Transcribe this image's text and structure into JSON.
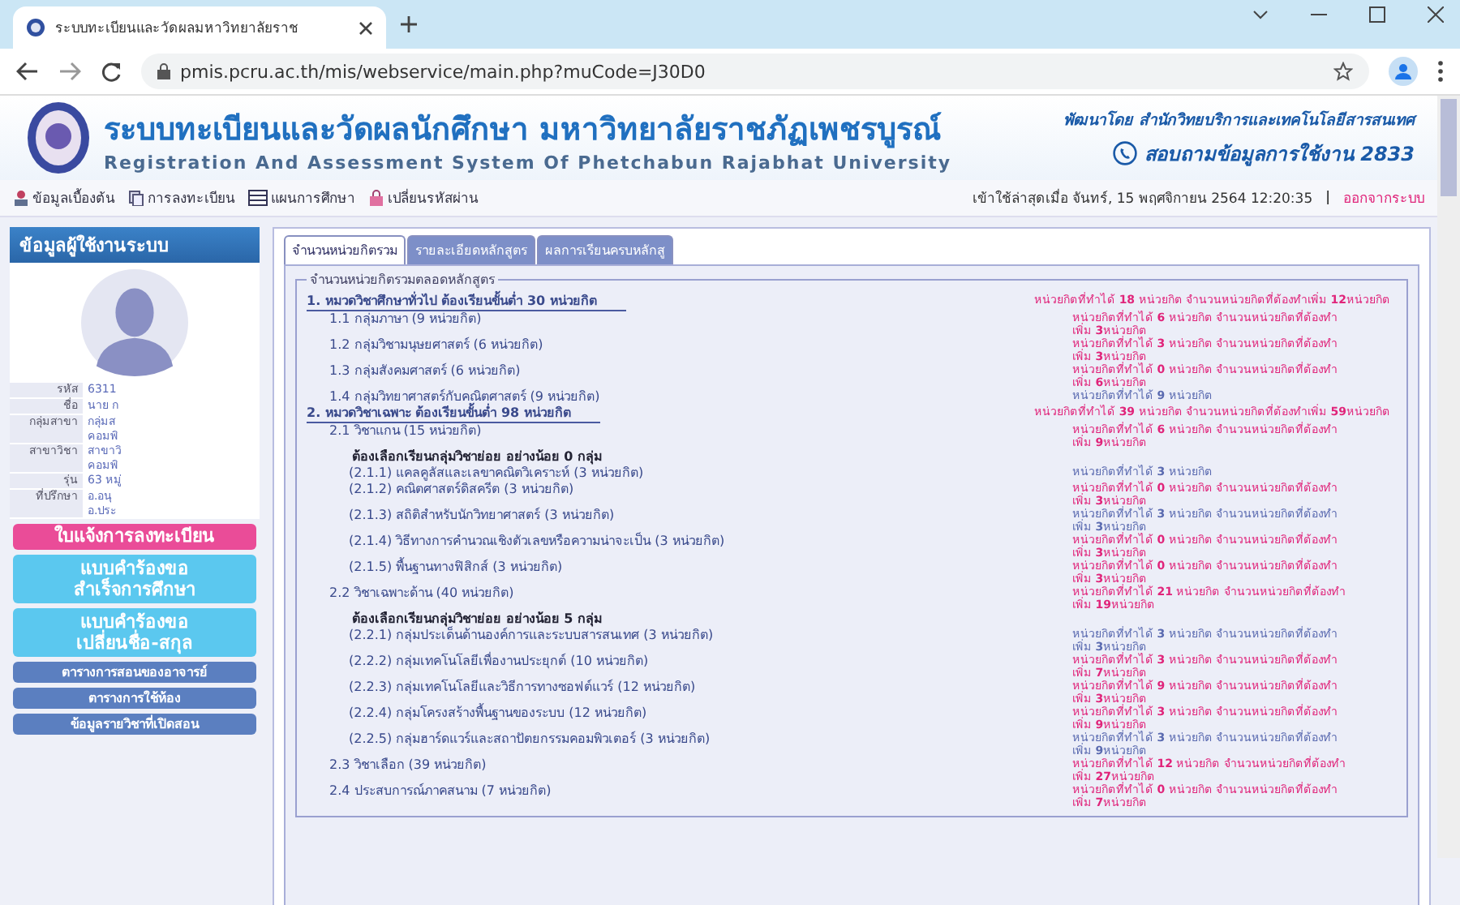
{
  "browser": {
    "tab_title": "ระบบทะเบียนและวัดผลมหาวิทยาลัยราช",
    "url": "pmis.pcru.ac.th/mis/webservice/main.php?muCode=J30D0"
  },
  "header": {
    "title": "ระบบทะเบียนและวัดผลนักศึกษา มหาวิทยาลัยราชภัฏเพชรบูรณ์",
    "subtitle": "Registration And Assessment System Of Phetchabun Rajabhat University",
    "developer": "พัฒนาโดย สำนักวิทยบริการและเทคโนโลยีสารสนเทศ",
    "contact": "สอบถามข้อมูลการใช้งาน 2833"
  },
  "nav": {
    "items": [
      "ข้อมูลเบื้องต้น",
      "การลงทะเบียน",
      "แผนการศึกษา",
      "เปลี่ยนรหัสผ่าน"
    ],
    "last_login": "เข้าใช้ล่าสุดเมื่อ จันทร์, 15 พฤศจิกายน 2564 12:20:35",
    "separator": "|",
    "logout": "ออกจากระบบ"
  },
  "sidebar": {
    "title": "ข้อมูลผู้ใช้งานระบบ",
    "profile": [
      {
        "label": "รหัส",
        "value": [
          "6311"
        ]
      },
      {
        "label": "ชื่อ",
        "value": [
          "นาย ก"
        ]
      },
      {
        "label": "กลุ่มสาขา",
        "value": [
          "กลุ่มส",
          "คอมพิ"
        ]
      },
      {
        "label": "สาขาวิชา",
        "value": [
          "สาขาวิ",
          "คอมพิ"
        ]
      },
      {
        "label": "รุ่น",
        "value": [
          "63 หมู่"
        ]
      },
      {
        "label": "ที่ปรึกษา",
        "value": [
          "อ.อนุ",
          "อ.ประ"
        ]
      }
    ],
    "buttons": [
      {
        "kind": "pink",
        "lines": [
          "ใบแจ้งการลงทะเบียน"
        ]
      },
      {
        "kind": "cyan",
        "lines": [
          "แบบคำร้องขอ",
          "สำเร็จการศึกษา"
        ]
      },
      {
        "kind": "cyan",
        "lines": [
          "แบบคำร้องขอ",
          "เปลี่ยนชื่อ-สกุล"
        ]
      },
      {
        "kind": "blue",
        "lines": [
          "ตารางการสอนของอาจารย์"
        ]
      },
      {
        "kind": "blue",
        "lines": [
          "ตารางการใช้ห้อง"
        ]
      },
      {
        "kind": "blue",
        "lines": [
          "ข้อมูลรายวิชาที่เปิดสอน"
        ]
      }
    ]
  },
  "tabs": [
    {
      "label": "จำนวนหน่วยกิตรวม",
      "selected": true
    },
    {
      "label": "รายละเอียดหลักสูตร",
      "selected": false
    },
    {
      "label": "ผลการเรียนครบหลักสู",
      "selected": false
    }
  ],
  "panel": {
    "legend": "จำนวนหน่วยกิตรวมตลอดหลักสูตร",
    "categories": [
      {
        "title": "1. หมวดวิชาศึกษาทั่วไป  ต้องเรียนขั้นต่ำ  30 หน่วยกิต",
        "complete": false,
        "status": [
          "หน่วยกิตที่ทำได้ **18** หน่วยกิต   จำนวนหน่วยกิตที่ต้องทำเพิ่ม  **12**หน่วยกิต"
        ],
        "children": [
          {
            "title": "1.1 กลุ่มภาษา (9 หน่วยกิต)",
            "complete": false,
            "status": [
              "หน่วยกิตที่ทำได้ **6** หน่วยกิต  จำนวนหน่วยกิตที่ต้องทำ",
              "เพิ่ม **3**หน่วยกิต"
            ]
          },
          {
            "title": "1.2 กลุ่มวิชามนุษยศาสตร์ (6 หน่วยกิต)",
            "complete": false,
            "status": [
              "หน่วยกิตที่ทำได้ **3** หน่วยกิต  จำนวนหน่วยกิตที่ต้องทำ",
              "เพิ่ม **3**หน่วยกิต"
            ]
          },
          {
            "title": "1.3 กลุ่มสังคมศาสตร์ (6 หน่วยกิต)",
            "complete": false,
            "status": [
              "หน่วยกิตที่ทำได้ **0** หน่วยกิต  จำนวนหน่วยกิตที่ต้องทำ",
              "เพิ่ม **6**หน่วยกิต"
            ]
          },
          {
            "title": "1.4 กลุ่มวิทยาศาสตร์กับคณิตศาสตร์ (9 หน่วยกิต)",
            "complete": true,
            "status": [
              "หน่วยกิตที่ทำได้ **9** หน่วยกิต"
            ]
          }
        ]
      },
      {
        "title": "2. หมวดวิชาเฉพาะ  ต้องเรียนขั้นต่ำ  98 หน่วยกิต",
        "complete": false,
        "status": [
          "หน่วยกิตที่ทำได้ **39** หน่วยกิต   จำนวนหน่วยกิตที่ต้องทำเพิ่ม  **59**หน่วยกิต"
        ],
        "children": [
          {
            "title": "2.1 วิชาแกน (15 หน่วยกิต)",
            "complete": false,
            "status": [
              "หน่วยกิตที่ทำได้ **6** หน่วยกิต  จำนวนหน่วยกิตที่ต้องทำ",
              "เพิ่ม **9**หน่วยกิต"
            ],
            "note": "ต้องเลือกเรียนกลุ่มวิชาย่อย อย่างน้อย 0 กลุ่ม",
            "children": [
              {
                "title": "(2.1.1) แคลคูลัสและเลขาคณิตวิเคราะห์ (3 หน่วยกิต)",
                "complete": true,
                "status": [
                  "หน่วยกิตที่ทำได้ **3** หน่วยกิต"
                ]
              },
              {
                "title": "(2.1.2) คณิตศาสตร์ดิสครีต (3 หน่วยกิต)",
                "complete": false,
                "status": [
                  "หน่วยกิตที่ทำได้ **0** หน่วยกิต  จำนวนหน่วยกิตที่ต้องทำ",
                  "เพิ่ม **3**หน่วยกิต"
                ]
              },
              {
                "title": "(2.1.3) สถิติสำหรับนักวิทยาศาสตร์ (3 หน่วยกิต)",
                "complete": true,
                "status": [
                  "หน่วยกิตที่ทำได้ **3** หน่วยกิต  จำนวนหน่วยกิตที่ต้องทำ",
                  "เพิ่ม **3**หน่วยกิต"
                ]
              },
              {
                "title": "(2.1.4) วิธีทางการคำนวณเชิงตัวเลขหรือความน่าจะเป็น (3 หน่วยกิต)",
                "complete": false,
                "status": [
                  "หน่วยกิตที่ทำได้ **0** หน่วยกิต  จำนวนหน่วยกิตที่ต้องทำ",
                  "เพิ่ม **3**หน่วยกิต"
                ]
              },
              {
                "title": "(2.1.5) พื้นฐานทางฟิสิกส์ (3 หน่วยกิต)",
                "complete": false,
                "status": [
                  "หน่วยกิตที่ทำได้ **0** หน่วยกิต  จำนวนหน่วยกิตที่ต้องทำ",
                  "เพิ่ม **3**หน่วยกิต"
                ]
              }
            ]
          },
          {
            "title": "2.2 วิชาเฉพาะด้าน (40 หน่วยกิต)",
            "complete": false,
            "status": [
              "หน่วยกิตที่ทำได้ **21** หน่วยกิต  จำนวนหน่วยกิตที่ต้องทำ",
              "เพิ่ม **19**หน่วยกิต"
            ],
            "note": "ต้องเลือกเรียนกลุ่มวิชาย่อย อย่างน้อย 5 กลุ่ม",
            "children": [
              {
                "title": "(2.2.1) กลุ่มประเด็นด้านองค์การและระบบสารสนเทศ (3 หน่วยกิต)",
                "complete": true,
                "status": [
                  "หน่วยกิตที่ทำได้ **3** หน่วยกิต  จำนวนหน่วยกิตที่ต้องทำ",
                  "เพิ่ม **3**หน่วยกิต"
                ]
              },
              {
                "title": "(2.2.2) กลุ่มเทคโนโลยีเพื่องานประยุกต์ (10 หน่วยกิต)",
                "complete": false,
                "status": [
                  "หน่วยกิตที่ทำได้ **3** หน่วยกิต  จำนวนหน่วยกิตที่ต้องทำ",
                  "เพิ่ม **7**หน่วยกิต"
                ]
              },
              {
                "title": "(2.2.3) กลุ่มเทคโนโลยีและวิธีการทางซอฟต์แวร์ (12 หน่วยกิต)",
                "complete": false,
                "status": [
                  "หน่วยกิตที่ทำได้ **9** หน่วยกิต  จำนวนหน่วยกิตที่ต้องทำ",
                  "เพิ่ม **3**หน่วยกิต"
                ]
              },
              {
                "title": "(2.2.4) กลุ่มโครงสร้างพื้นฐานของระบบ (12 หน่วยกิต)",
                "complete": false,
                "status": [
                  "หน่วยกิตที่ทำได้ **3** หน่วยกิต  จำนวนหน่วยกิตที่ต้องทำ",
                  "เพิ่ม **9**หน่วยกิต"
                ]
              },
              {
                "title": "(2.2.5) กลุ่มฮาร์ดแวร์และสถาปัตยกรรมคอมพิวเตอร์ (3 หน่วยกิต)",
                "complete": true,
                "status": [
                  "หน่วยกิตที่ทำได้ **3** หน่วยกิต  จำนวนหน่วยกิตที่ต้องทำ",
                  "เพิ่ม **9**หน่วยกิต"
                ]
              }
            ]
          },
          {
            "title": "2.3 วิชาเลือก (39 หน่วยกิต)",
            "complete": false,
            "status": [
              "หน่วยกิตที่ทำได้ **12** หน่วยกิต  จำนวนหน่วยกิตที่ต้องทำ",
              "เพิ่ม **27**หน่วยกิต"
            ]
          },
          {
            "title": "2.4 ประสบการณ์ภาคสนาม (7 หน่วยกิต)",
            "complete": false,
            "status": [
              "หน่วยกิตที่ทำได้ **0** หน่วยกิต  จำนวนหน่วยกิตที่ต้องทำ",
              "เพิ่ม **7**หน่วยกิต"
            ]
          }
        ]
      }
    ]
  }
}
